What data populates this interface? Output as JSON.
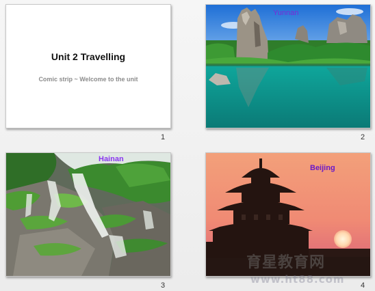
{
  "slides": [
    {
      "number": "1",
      "title": "Unit 2 Travelling",
      "subtitle": "Comic strip ~ Welcome to the unit"
    },
    {
      "number": "2",
      "caption": "Yunnan"
    },
    {
      "number": "3",
      "caption": "Hainan"
    },
    {
      "number": "4",
      "caption": "Beijing"
    }
  ],
  "watermark": {
    "text": "育星教育网",
    "url": "www.ht88.com"
  },
  "colors": {
    "caption_purple": "#6a18c8",
    "background": "#f2f2f2"
  }
}
